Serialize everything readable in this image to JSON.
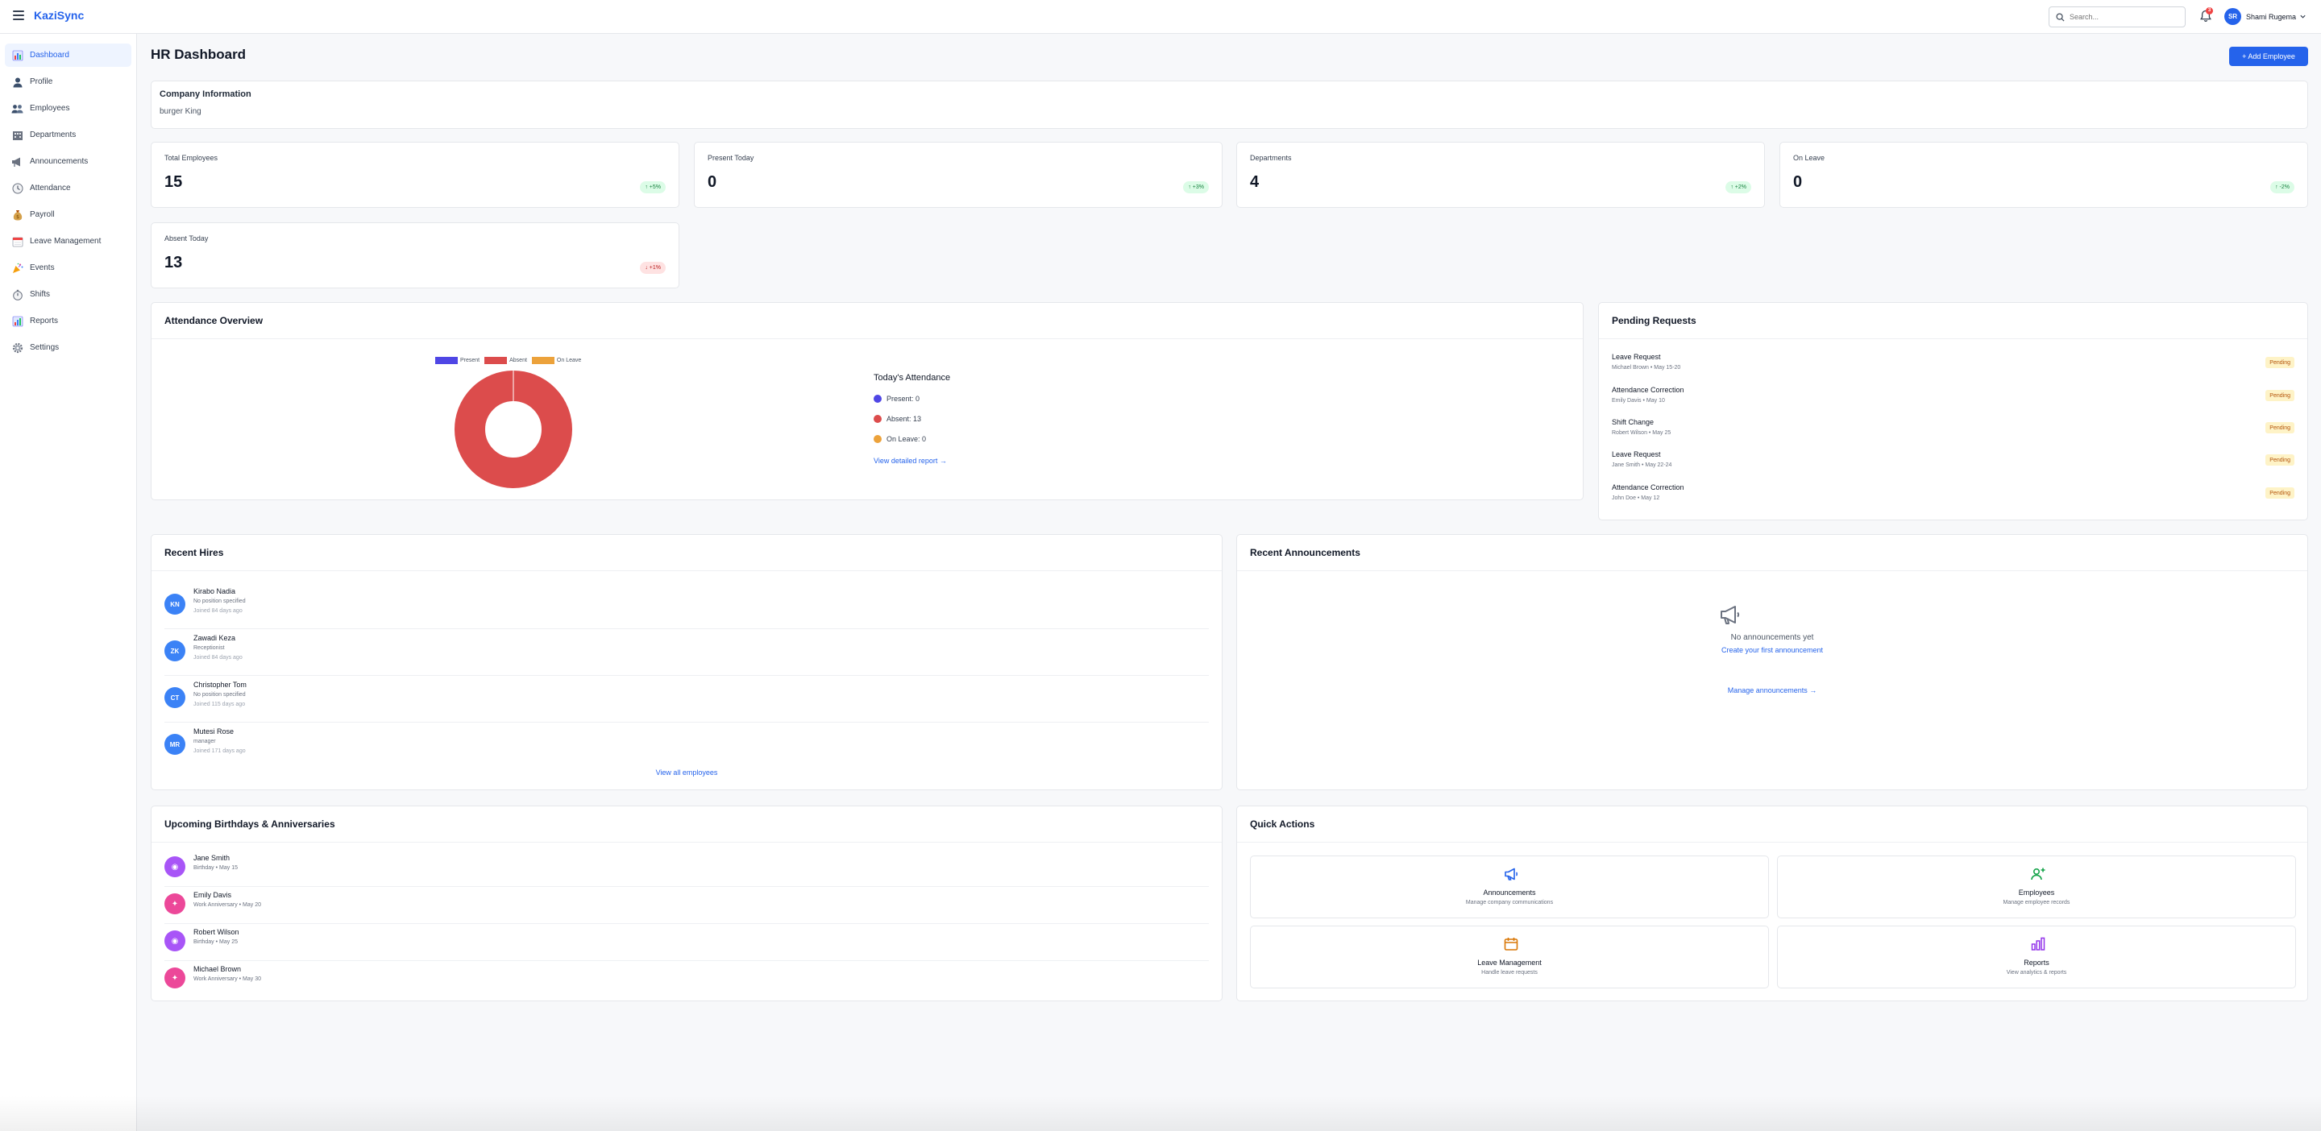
{
  "app": {
    "brand": "KaziSync"
  },
  "header": {
    "search_placeholder": "Search...",
    "notification_count": "3",
    "user_initials": "SR",
    "user_name": "Shami Rugema"
  },
  "sidebar": {
    "items": [
      {
        "label": "Dashboard",
        "icon": "bar-chart-icon",
        "active": true
      },
      {
        "label": "Profile",
        "icon": "user-icon"
      },
      {
        "label": "Employees",
        "icon": "users-icon"
      },
      {
        "label": "Departments",
        "icon": "building-icon"
      },
      {
        "label": "Announcements",
        "icon": "megaphone-icon"
      },
      {
        "label": "Attendance",
        "icon": "clock-icon"
      },
      {
        "label": "Payroll",
        "icon": "money-bag-icon"
      },
      {
        "label": "Leave Management",
        "icon": "calendar-icon"
      },
      {
        "label": "Events",
        "icon": "party-icon"
      },
      {
        "label": "Shifts",
        "icon": "stopwatch-icon"
      },
      {
        "label": "Reports",
        "icon": "chart-icon"
      },
      {
        "label": "Settings",
        "icon": "gear-icon"
      }
    ]
  },
  "main": {
    "title": "HR Dashboard",
    "add_button": "+ Add Employee",
    "company": {
      "title": "Company Information",
      "name": "burger King"
    },
    "stats": [
      {
        "label": "Total Employees",
        "value": "15",
        "badge": "↑ +5%",
        "trend": "up"
      },
      {
        "label": "Present Today",
        "value": "0",
        "badge": "↑ +3%",
        "trend": "up"
      },
      {
        "label": "Departments",
        "value": "4",
        "badge": "↑ +2%",
        "trend": "up"
      },
      {
        "label": "On Leave",
        "value": "0",
        "badge": "↑ -2%",
        "trend": "up"
      },
      {
        "label": "Absent Today",
        "value": "13",
        "badge": "↓ +1%",
        "trend": "down"
      }
    ],
    "attendance": {
      "title": "Attendance Overview",
      "legend": [
        "Present",
        "Absent",
        "On Leave"
      ],
      "today_title": "Today's Attendance",
      "rows": [
        "Present: 0",
        "Absent: 13",
        "On Leave: 0"
      ],
      "link": "View detailed report →"
    },
    "pending": {
      "title": "Pending Requests",
      "items": [
        {
          "title": "Leave Request",
          "sub": "Michael Brown • May 15-20",
          "status": "Pending"
        },
        {
          "title": "Attendance Correction",
          "sub": "Emily Davis • May 10",
          "status": "Pending"
        },
        {
          "title": "Shift Change",
          "sub": "Robert Wilson • May 25",
          "status": "Pending"
        },
        {
          "title": "Leave Request",
          "sub": "Jane Smith • May 22-24",
          "status": "Pending"
        },
        {
          "title": "Attendance Correction",
          "sub": "John Doe • May 12",
          "status": "Pending"
        }
      ]
    },
    "recent_hires": {
      "title": "Recent Hires",
      "items": [
        {
          "initials": "KN",
          "name": "Kirabo Nadia",
          "position": "No position specified",
          "joined": "Joined 84 days ago"
        },
        {
          "initials": "ZK",
          "name": "Zawadi Keza",
          "position": "Receptionist",
          "joined": "Joined 84 days ago"
        },
        {
          "initials": "CT",
          "name": "Christopher Tom",
          "position": "No position specified",
          "joined": "Joined 115 days ago"
        },
        {
          "initials": "MR",
          "name": "Mutesi Rose",
          "position": "manager",
          "joined": "Joined 171 days ago"
        }
      ],
      "link": "View all employees"
    },
    "announcements": {
      "title": "Recent Announcements",
      "empty": "No announcements yet",
      "create_link": "Create your first announcement",
      "manage_link": "Manage announcements →"
    },
    "birthdays": {
      "title": "Upcoming Birthdays & Anniversaries",
      "items": [
        {
          "name": "Jane Smith",
          "sub": "Birthday • May 15",
          "type": "birthday",
          "color": "#a855f7"
        },
        {
          "name": "Emily Davis",
          "sub": "Work Anniversary • May 20",
          "type": "anniversary",
          "color": "#ec4899"
        },
        {
          "name": "Robert Wilson",
          "sub": "Birthday • May 25",
          "type": "birthday",
          "color": "#a855f7"
        },
        {
          "name": "Michael Brown",
          "sub": "Work Anniversary • May 30",
          "type": "anniversary",
          "color": "#ec4899"
        }
      ]
    },
    "quick_actions": {
      "title": "Quick Actions",
      "items": [
        {
          "title": "Announcements",
          "sub": "Manage company communications",
          "icon": "megaphone-icon",
          "color": "#2563eb"
        },
        {
          "title": "Employees",
          "sub": "Manage employee records",
          "icon": "user-plus-icon",
          "color": "#16a34a"
        },
        {
          "title": "Leave Management",
          "sub": "Handle leave requests",
          "icon": "calendar-icon",
          "color": "#d97706"
        },
        {
          "title": "Reports",
          "sub": "View analytics & reports",
          "icon": "bar-chart-icon",
          "color": "#9333ea"
        }
      ]
    }
  },
  "colors": {
    "accent": "#2563eb",
    "present": "#4f46e5",
    "absent": "#dc4c4c",
    "on_leave": "#eca23b"
  }
}
